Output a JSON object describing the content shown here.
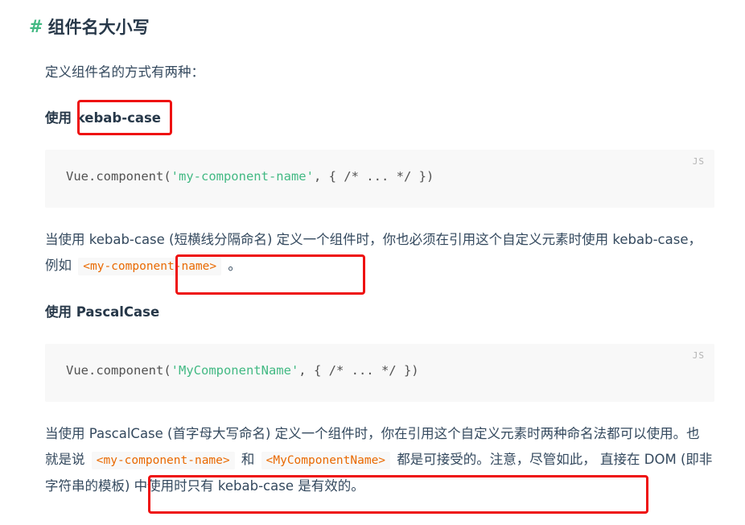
{
  "heading": {
    "hash": "#",
    "title": "组件名大小写"
  },
  "intro": "定义组件名的方式有两种：",
  "section1": {
    "prefix": "使用",
    "name": "kebab-case",
    "code": {
      "lang": "JS",
      "pre": "Vue.component(",
      "string": "'my-component-name'",
      "post": ", { /* ... */ })"
    },
    "desc_part1": "当使用 kebab-case (短横线分隔命名) 定义一个组件时，你也必须在引用这个自定义元素时使用 kebab-case，例如",
    "inline": "<my-component-name>",
    "desc_end": "。"
  },
  "section2": {
    "prefix": "使用",
    "name": "PascalCase",
    "code": {
      "lang": "JS",
      "pre": "Vue.component(",
      "string": "'MyComponentName'",
      "post": ", { /* ... */ })"
    },
    "desc_part1": "当使用 PascalCase (首字母大写命名) 定义一个组件时，你在引用这个自定义元素时两种命名法都可以使用。也就是说",
    "inline1": "<my-component-name>",
    "and": "和",
    "inline2": "<MyComponentName>",
    "desc_part2": "都是可接受的。注意，尽管如此，",
    "desc_part3": "直接在 DOM (即非字符串的模板) 中使用时只有 kebab-case 是有效的。"
  },
  "colors": {
    "accent": "#42b983",
    "inline_code": "#e96900",
    "highlight_box": "#ee1111"
  }
}
